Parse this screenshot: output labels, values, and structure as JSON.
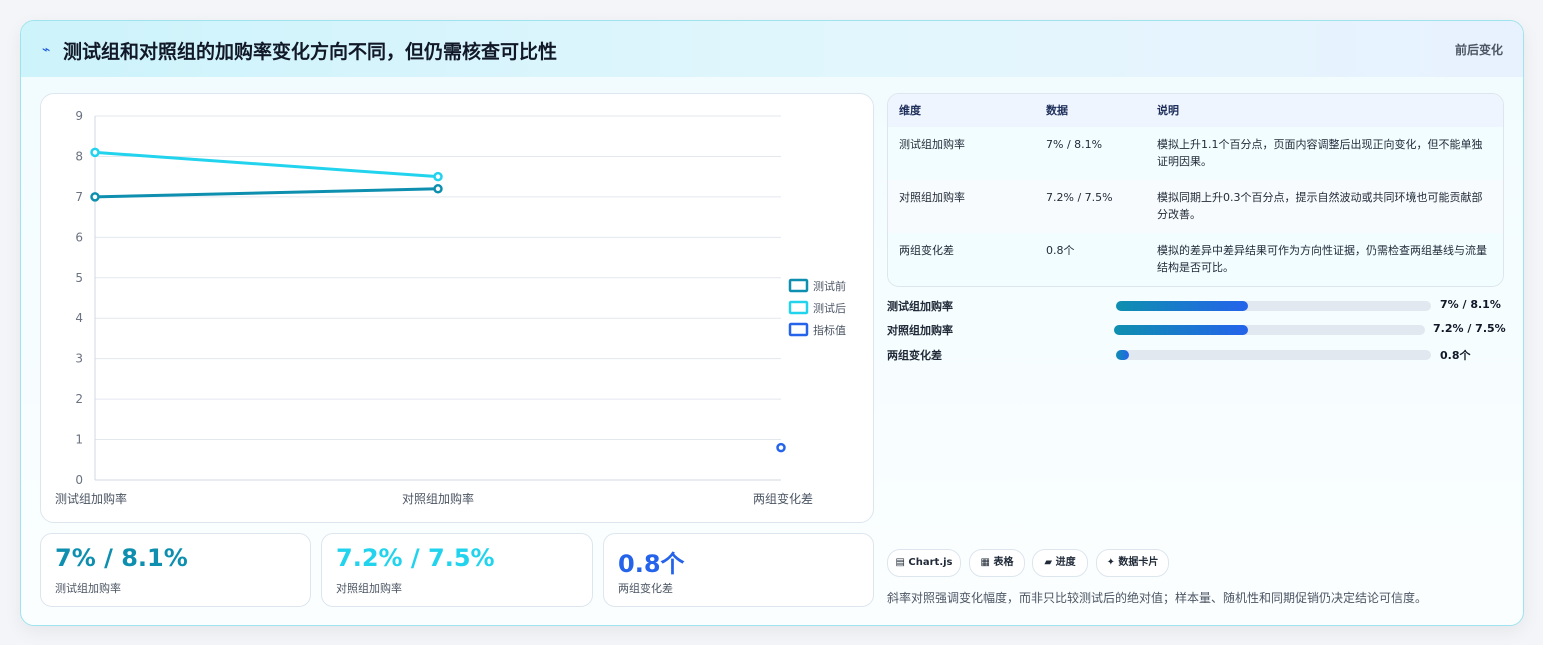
{
  "header": {
    "icon": "pulse-icon",
    "icon_glyph": "⌁",
    "title": "测试组和对照组的加购率变化方向不同，但仍需核查可比性",
    "badge": "前后变化"
  },
  "chart_data": {
    "type": "line",
    "categories": [
      "测试组加购率",
      "对照组加购率",
      "两组变化差"
    ],
    "series": [
      {
        "name": "测试前",
        "values": [
          7.0,
          7.2,
          null
        ],
        "color": "#0e8faf"
      },
      {
        "name": "测试后",
        "values": [
          8.1,
          7.5,
          null
        ],
        "color": "#22d3ee"
      },
      {
        "name": "指标值",
        "values": [
          null,
          null,
          0.8
        ],
        "color": "#2563eb"
      }
    ],
    "ylim": [
      0,
      9
    ],
    "yticks": [
      "0",
      "1",
      "2",
      "3",
      "4",
      "5",
      "6",
      "7",
      "8",
      "9"
    ],
    "grid": true,
    "legend": "right"
  },
  "kpis": [
    {
      "value": "7% / 8.1%",
      "label": "测试组加购率",
      "color": "#0e8faf"
    },
    {
      "value": "7.2% / 7.5%",
      "label": "对照组加购率",
      "color": "#22d3ee"
    },
    {
      "value": "0.8个",
      "label": "两组变化差",
      "color": "#2563eb"
    }
  ],
  "table": {
    "headers": [
      "维度",
      "数据",
      "说明"
    ],
    "rows": [
      {
        "dim": "测试组加购率",
        "data": "7% / 8.1%",
        "note": "模拟上升1.1个百分点，页面内容调整后出现正向变化，但不能单独证明因果。"
      },
      {
        "dim": "对照组加购率",
        "data": "7.2% / 7.5%",
        "note": "模拟同期上升0.3个百分点，提示自然波动或共同环境也可能贡献部分改善。"
      },
      {
        "dim": "两组变化差",
        "data": "0.8个",
        "note": "模拟的差异中差异结果可作为方向性证据，仍需检查两组基线与流量结构是否可比。"
      }
    ]
  },
  "bars": [
    {
      "label": "测试组加购率",
      "value": "7% / 8.1%",
      "fraction": 0.42
    },
    {
      "label": "对照组加购率",
      "value": "7.2% / 7.5%",
      "fraction": 0.43
    },
    {
      "label": "两组变化差",
      "value": "0.8个",
      "fraction": 0.04
    }
  ],
  "tags": [
    {
      "icon": "chart-icon",
      "label": "▤ Chart.js"
    },
    {
      "icon": "table-icon",
      "label": "▦ 表格"
    },
    {
      "icon": "progress-icon",
      "label": "▰ 进度"
    },
    {
      "icon": "sparkle-icon",
      "label": "✦ 数据卡片"
    }
  ],
  "footnote": "斜率对照强调变化幅度，而非只比较测试后的绝对值；样本量、随机性和同期促销仍决定结论可信度。"
}
